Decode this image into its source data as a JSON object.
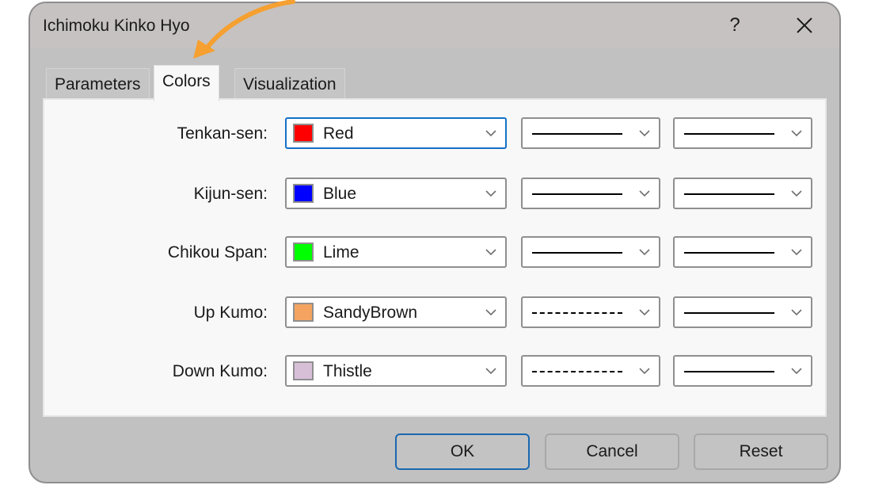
{
  "window": {
    "title": "Ichimoku Kinko Hyo",
    "help_label": "?",
    "close_icon": "close-icon"
  },
  "tabs": [
    {
      "label": "Parameters",
      "active": false
    },
    {
      "label": "Colors",
      "active": true
    },
    {
      "label": "Visualization",
      "active": false
    }
  ],
  "annotation": {
    "type": "curved-arrow",
    "color": "#f5a030",
    "points_to": "Colors tab"
  },
  "rows": [
    {
      "label": "Tenkan-sen:",
      "color_name": "Red",
      "color_hex": "#ff0000",
      "style": "solid",
      "width": "solid",
      "focused": true
    },
    {
      "label": "Kijun-sen:",
      "color_name": "Blue",
      "color_hex": "#0000ff",
      "style": "solid",
      "width": "solid",
      "focused": false
    },
    {
      "label": "Chikou Span:",
      "color_name": "Lime",
      "color_hex": "#00ff00",
      "style": "solid",
      "width": "solid",
      "focused": false
    },
    {
      "label": "Up Kumo:",
      "color_name": "SandyBrown",
      "color_hex": "#f4a460",
      "style": "dashed",
      "width": "solid",
      "focused": false
    },
    {
      "label": "Down Kumo:",
      "color_name": "Thistle",
      "color_hex": "#d8bfd8",
      "style": "dashed",
      "width": "solid",
      "focused": false
    }
  ],
  "buttons": {
    "ok": "OK",
    "cancel": "Cancel",
    "reset": "Reset"
  }
}
